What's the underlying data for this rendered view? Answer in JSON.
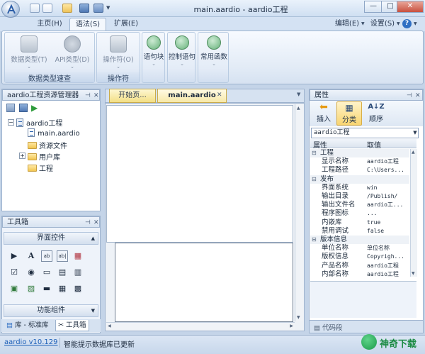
{
  "window": {
    "title": "main.aardio - aardio工程"
  },
  "ribbon": {
    "tabs": [
      {
        "label": "主页(H)"
      },
      {
        "label": "语法(S)"
      },
      {
        "label": "扩展(E)"
      }
    ],
    "right_menu": {
      "edit": "编辑(E)",
      "settings": "设置(S)",
      "help": "?"
    },
    "groups": [
      {
        "caption": "数据类型速查",
        "buttons": [
          "数据类型(T)",
          "API类型(D)"
        ]
      },
      {
        "caption": "操作符",
        "buttons": [
          "操作符(O)"
        ]
      },
      {
        "caption": "",
        "buttons": [
          "语句块"
        ]
      },
      {
        "caption": "",
        "buttons": [
          "控制语句"
        ]
      },
      {
        "caption": "",
        "buttons": [
          "常用函数"
        ]
      }
    ]
  },
  "project_pane": {
    "title": "aardio工程资源管理器",
    "tree": {
      "root": "aardio工程",
      "items": [
        "main.aardio",
        "资源文件",
        "用户库",
        "工程"
      ]
    }
  },
  "toolbox": {
    "title": "工具箱",
    "section_ui": "界面控件",
    "section_func": "功能组件",
    "tools": [
      "▶",
      "A",
      "ab",
      "ab|",
      "▦",
      "☑",
      "◉",
      "▭",
      "▤",
      "▥",
      "▣",
      "▨",
      "▬",
      "▦",
      "▩"
    ]
  },
  "bottom_tabs": [
    {
      "label": "库 - 标准库"
    },
    {
      "label": "工具箱"
    }
  ],
  "editor": {
    "tabs": [
      {
        "label": "开始页..."
      },
      {
        "label": "main.aardio"
      }
    ]
  },
  "properties": {
    "title": "属性",
    "toolbar": [
      "插入",
      "分类",
      "顺序"
    ],
    "object": "aardio工程",
    "columns": {
      "name": "属性",
      "value": "取值"
    },
    "rows": [
      {
        "type": "cat",
        "name": "工程"
      },
      {
        "type": "prop",
        "name": "显示名称",
        "value": "aardio工程"
      },
      {
        "type": "prop",
        "name": "工程路径",
        "value": "C:\\Users..."
      },
      {
        "type": "cat",
        "name": "发布"
      },
      {
        "type": "prop",
        "name": "界面系统",
        "value": "win"
      },
      {
        "type": "prop",
        "name": "输出目录",
        "value": "/Publish/"
      },
      {
        "type": "prop",
        "name": "输出文件名",
        "value": "aardio工..."
      },
      {
        "type": "prop",
        "name": "程序图标",
        "value": "..."
      },
      {
        "type": "prop",
        "name": "内嵌库",
        "value": "true"
      },
      {
        "type": "prop",
        "name": "禁用调试",
        "value": "false"
      },
      {
        "type": "cat",
        "name": "版本信息"
      },
      {
        "type": "prop",
        "name": "单位名称",
        "value": "单位名称"
      },
      {
        "type": "prop",
        "name": "版权信息",
        "value": "Copyrigh..."
      },
      {
        "type": "prop",
        "name": "产品名称",
        "value": "aardio工程"
      },
      {
        "type": "prop",
        "name": "内部名称",
        "value": "aardio工程"
      }
    ],
    "footer_tab": "代码段"
  },
  "status": {
    "version": "aardio v10.129",
    "message": "智能提示数据库已更新"
  },
  "watermark": {
    "text": "神奇下载"
  },
  "colors": {
    "accent": "#f8d571",
    "frame": "#9eb3ce",
    "ribbon": "#dbe6f4"
  }
}
